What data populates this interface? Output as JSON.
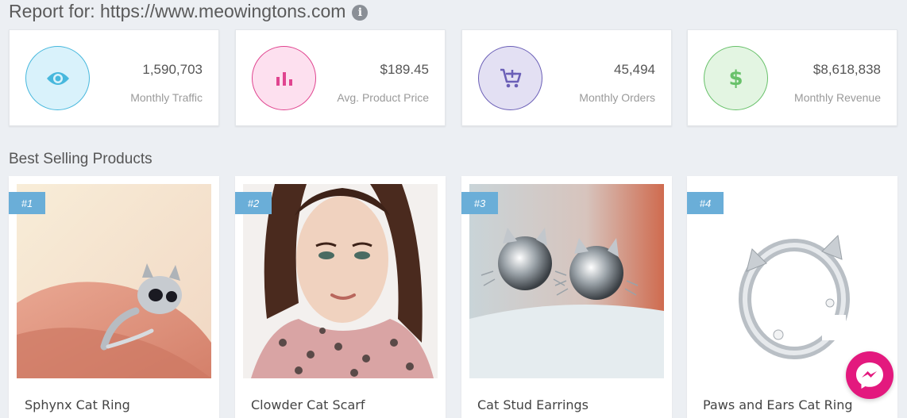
{
  "report": {
    "title": "Report for: https://www.meowingtons.com"
  },
  "stats": [
    {
      "value": "1,590,703",
      "label": "Monthly Traffic",
      "icon": "eye-icon",
      "color": "#47b8dd"
    },
    {
      "value": "$189.45",
      "label": "Avg. Product Price",
      "icon": "bar-chart-icon",
      "color": "#e0448f"
    },
    {
      "value": "45,494",
      "label": "Monthly Orders",
      "icon": "cart-plus-icon",
      "color": "#6b5fb7"
    },
    {
      "value": "$8,618,838",
      "label": "Monthly Revenue",
      "icon": "dollar-icon",
      "color": "#68c16a"
    }
  ],
  "best_selling": {
    "title": "Best Selling Products",
    "products": [
      {
        "rank": "#1",
        "name": "Sphynx Cat Ring"
      },
      {
        "rank": "#2",
        "name": "Clowder Cat Scarf"
      },
      {
        "rank": "#3",
        "name": "Cat Stud Earrings"
      },
      {
        "rank": "#4",
        "name": "Paws and Ears Cat Ring"
      }
    ]
  },
  "colors": {
    "badge": "#6aaed8",
    "messenger": "#e3197e",
    "background": "#eceff3"
  }
}
